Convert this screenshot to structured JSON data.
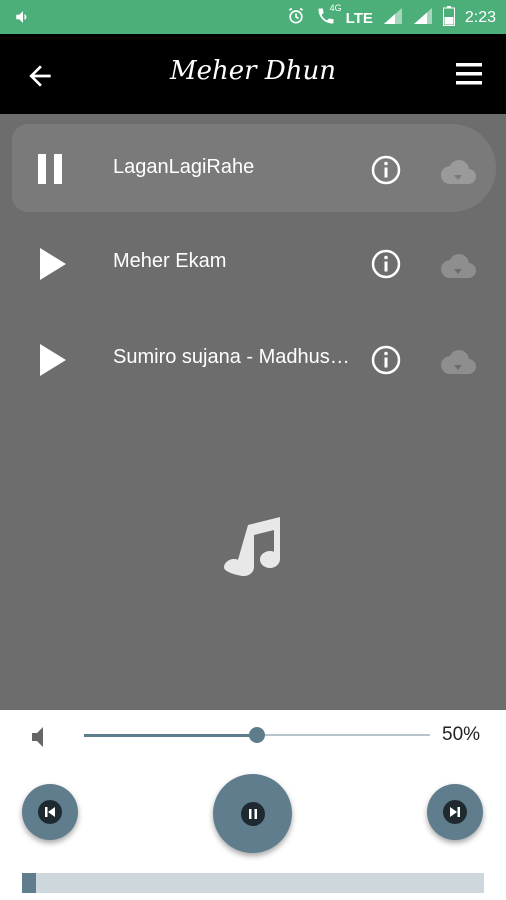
{
  "status_bar": {
    "time": "2:23",
    "network": "LTE",
    "network_small": "4G"
  },
  "app_bar": {
    "title": "Meher Dhun"
  },
  "tracks": [
    {
      "title": "LaganLagiRahe",
      "state": "playing"
    },
    {
      "title": "Meher Ekam",
      "state": "paused"
    },
    {
      "title": "Sumiro sujana - Madhusudan Ji",
      "state": "paused"
    }
  ],
  "player": {
    "volume_value": 0.5,
    "volume_label": "50%",
    "track_progress": 0.03
  },
  "colors": {
    "status_bar": "#4caf7a",
    "accent": "#5f7d8c",
    "list_bg": "#6d6d6d",
    "active_row": "#7a7a7a"
  }
}
